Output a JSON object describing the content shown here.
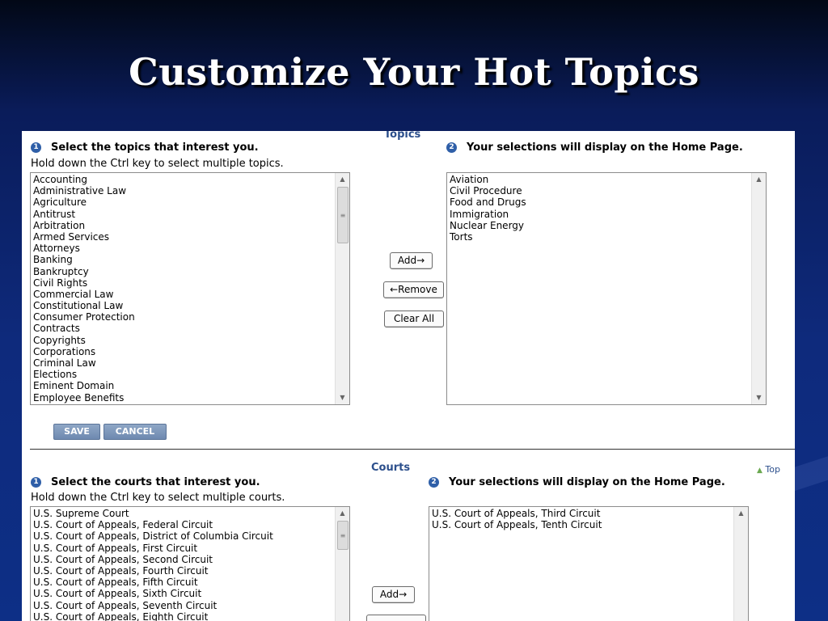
{
  "slide": {
    "title": "Customize Your Hot Topics"
  },
  "topics": {
    "section_title": "Topics",
    "step1_number": "1",
    "step1_label": "Select the topics that interest you.",
    "hint": "Hold down the Ctrl key to select multiple topics.",
    "step2_number": "2",
    "step2_label": "Your selections will display on the Home Page.",
    "available": [
      "Accounting",
      "Administrative Law",
      "Agriculture",
      "Antitrust",
      "Arbitration",
      "Armed Services",
      "Attorneys",
      "Banking",
      "Bankruptcy",
      "Civil Rights",
      "Commercial Law",
      "Constitutional Law",
      "Consumer Protection",
      "Contracts",
      "Copyrights",
      "Corporations",
      "Criminal Law",
      "Elections",
      "Eminent Domain",
      "Employee Benefits"
    ],
    "selected": [
      "Aviation",
      "Civil Procedure",
      "Food and Drugs",
      "Immigration",
      "Nuclear Energy",
      "Torts"
    ],
    "add_label": "Add→",
    "remove_label": "←Remove",
    "clear_label": "Clear All",
    "save_label": "SAVE",
    "cancel_label": "CANCEL"
  },
  "courts": {
    "section_title": "Courts",
    "top_link": "Top",
    "step1_number": "1",
    "step1_label": "Select the courts that interest you.",
    "hint": "Hold down the Ctrl key to select multiple courts.",
    "step2_number": "2",
    "step2_label": "Your selections will display on the Home Page.",
    "available": [
      "U.S. Supreme Court",
      "U.S. Court of Appeals, Federal Circuit",
      "U.S. Court of Appeals, District of Columbia Circuit",
      "U.S. Court of Appeals, First Circuit",
      "U.S. Court of Appeals, Second Circuit",
      "U.S. Court of Appeals, Fourth Circuit",
      "U.S. Court of Appeals, Fifth Circuit",
      "U.S. Court of Appeals, Sixth Circuit",
      "U.S. Court of Appeals, Seventh Circuit",
      "U.S. Court of Appeals, Eighth Circuit"
    ],
    "selected": [
      "U.S. Court of Appeals, Third Circuit",
      "U.S. Court of Appeals, Tenth Circuit"
    ],
    "add_label": "Add→"
  },
  "icons": {
    "scroll_up": "scroll-up-arrow-icon",
    "scroll_down": "scroll-down-arrow-icon",
    "top_arrow": "up-arrow-icon"
  },
  "colors": {
    "background": "#0d2f86",
    "section_title": "#2c4f8c",
    "step_icon": "#2f5fa8",
    "form_button": "#7a93b8"
  }
}
